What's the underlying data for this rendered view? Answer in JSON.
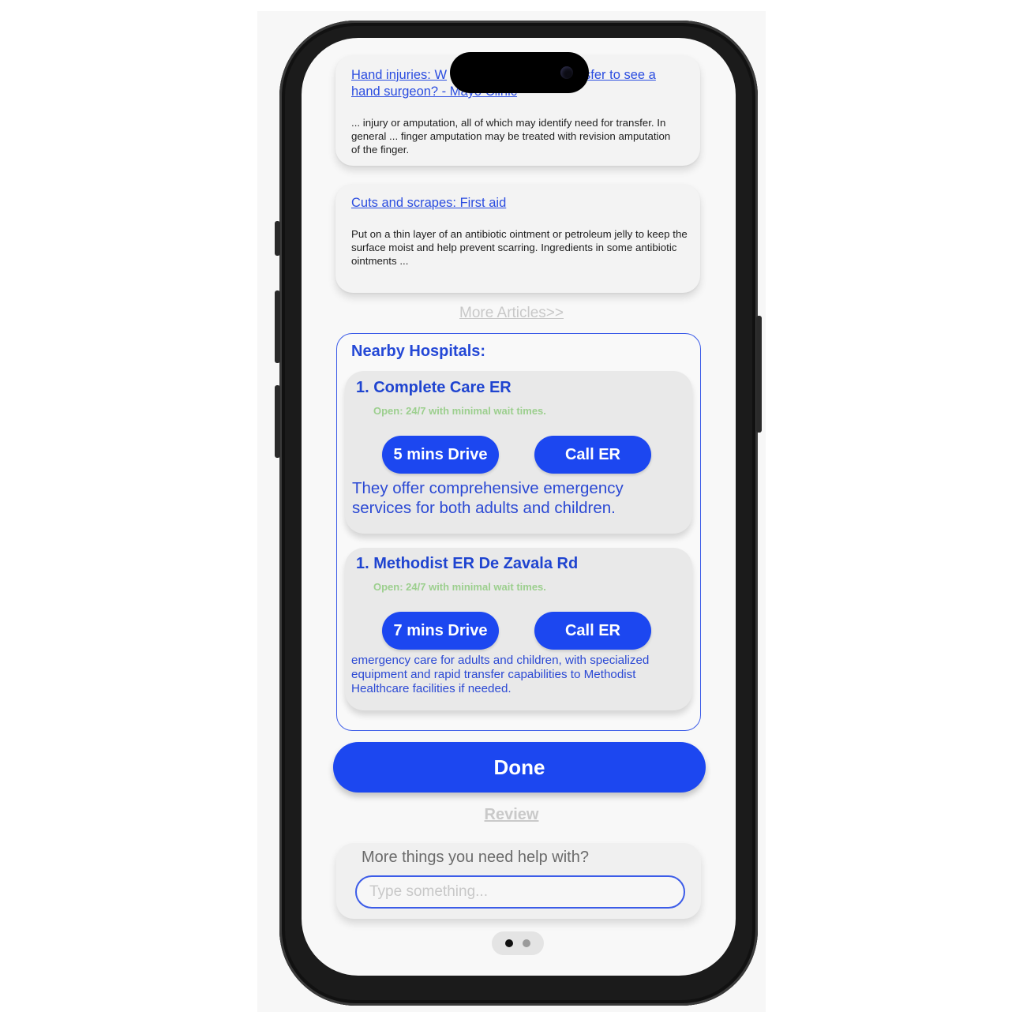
{
  "articles": [
    {
      "title_line1_left": "Hand injuries: W",
      "title_line1_right": "sfer to see a",
      "title_line2": "hand surgeon? - Mayo Clinic",
      "snippet": "... injury or amputation, all of which may identify need for transfer. In general ... finger amputation may be treated with revision amputation of the finger."
    },
    {
      "title": "Cuts and scrapes: First aid",
      "snippet": "Put on a thin layer of an antibiotic ointment or petroleum jelly to keep the surface moist and help prevent scarring. Ingredients in some antibiotic ointments ..."
    }
  ],
  "more_articles_label": "More Articles>>",
  "nearby": {
    "title": "Nearby Hospitals:",
    "hospitals": [
      {
        "name": "1. Complete Care ER",
        "hours": "Open: 24/7 with minimal wait times.",
        "drive_label": "5 mins Drive",
        "call_label": "Call ER",
        "description": "They offer comprehensive emergency services for both adults and children."
      },
      {
        "name": "1. Methodist ER De Zavala Rd",
        "hours": "Open: 24/7 with minimal wait times.",
        "drive_label": "7 mins Drive",
        "call_label": "Call ER",
        "description": "emergency care for adults and children, with specialized equipment and rapid transfer capabilities to Methodist Healthcare facilities if needed."
      }
    ]
  },
  "done_label": "Done",
  "review_label": "Review",
  "help": {
    "label": "More things you need help with?",
    "placeholder": "Type something..."
  },
  "pager": {
    "count": 2,
    "active_index": 0
  },
  "colors": {
    "accent": "#1c47f0",
    "accent_text": "#2b49d4",
    "open_status": "#9ccf8e",
    "muted_link": "#c8c8c8"
  }
}
